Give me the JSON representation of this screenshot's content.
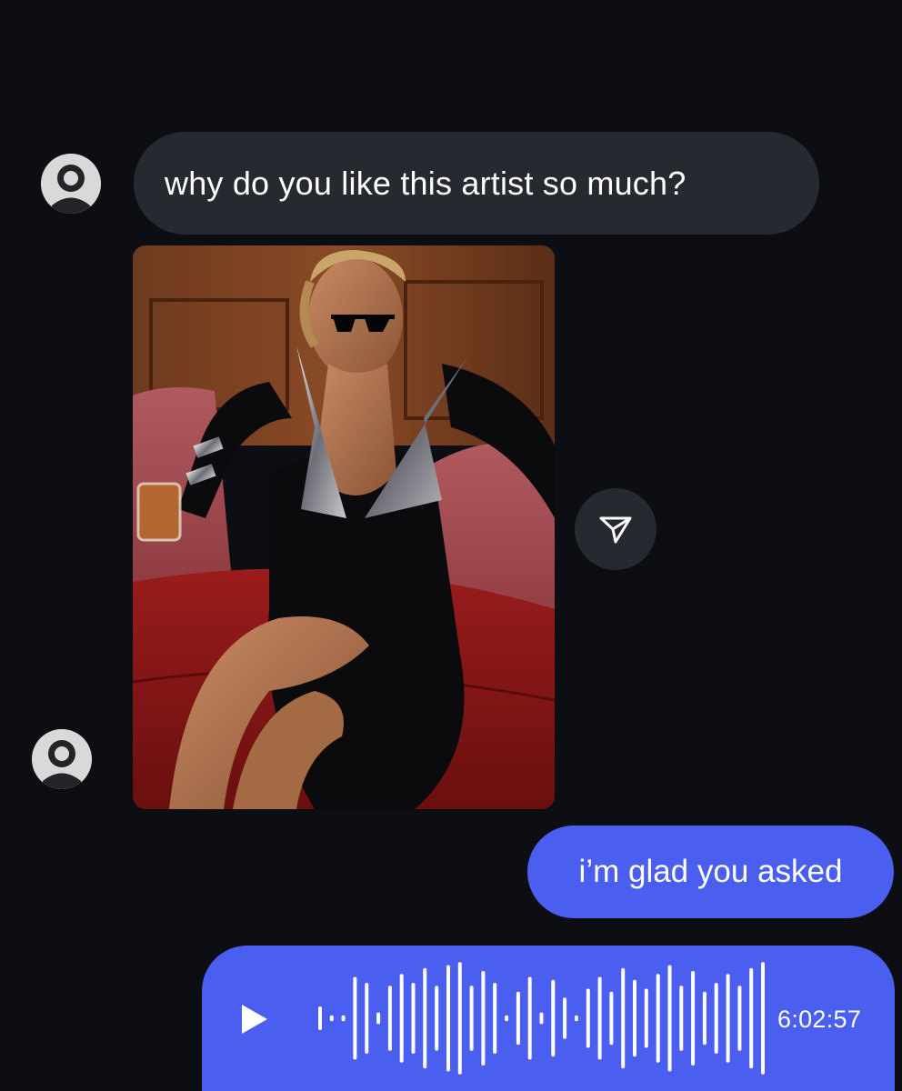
{
  "thread": {
    "incoming_message": "why do you like this artist so much?",
    "outgoing_message": "i’m glad you asked",
    "voice_message": {
      "duration": "6:02:57",
      "play_icon": "play-icon",
      "waveform_levels": [
        0.2,
        0.05,
        0.05,
        0.7,
        0.6,
        0.1,
        0.55,
        0.75,
        0.6,
        0.85,
        0.55,
        0.9,
        0.95,
        0.55,
        0.8,
        0.6,
        0.05,
        0.45,
        0.7,
        0.1,
        0.65,
        0.35,
        0.05,
        0.5,
        0.7,
        0.45,
        0.85,
        0.65,
        0.5,
        0.75,
        0.9,
        0.55,
        0.8,
        0.45,
        0.6,
        0.75,
        0.55,
        0.85,
        0.95
      ]
    },
    "shared_photo_icon": "send-icon",
    "avatar_icon": "default-avatar-icon"
  },
  "colors": {
    "background": "#0d0e14",
    "incoming_bubble": "#272930",
    "outgoing_bubble": "#4a5ef0",
    "text": "#ffffff"
  }
}
